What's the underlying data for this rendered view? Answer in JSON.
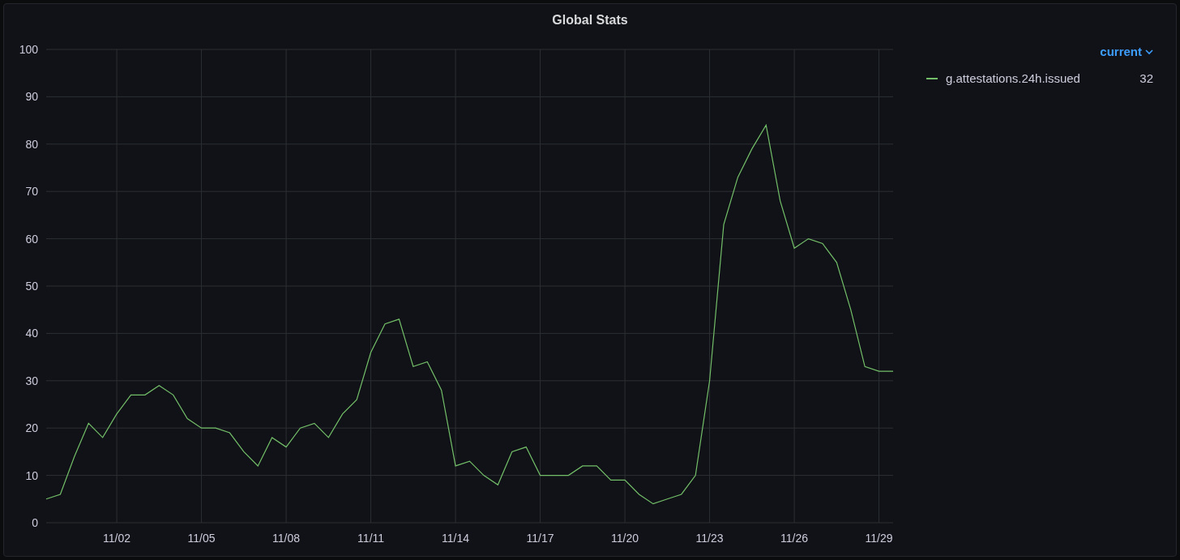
{
  "panel": {
    "title": "Global Stats",
    "chart_data": {
      "type": "line",
      "grid": true,
      "ylim": [
        0,
        100
      ],
      "yticks": [
        0,
        10,
        20,
        30,
        40,
        50,
        60,
        70,
        80,
        90,
        100
      ],
      "categories": [
        null,
        null,
        null,
        null,
        null,
        "11/02",
        null,
        null,
        null,
        null,
        null,
        "11/05",
        null,
        null,
        null,
        null,
        null,
        "11/08",
        null,
        null,
        null,
        null,
        null,
        "11/11",
        null,
        null,
        null,
        null,
        null,
        "11/14",
        null,
        null,
        null,
        null,
        null,
        "11/17",
        null,
        null,
        null,
        null,
        null,
        "11/20",
        null,
        null,
        null,
        null,
        null,
        "11/23",
        null,
        null,
        null,
        null,
        null,
        "11/26",
        null,
        null,
        null,
        null,
        null,
        "11/29",
        null
      ],
      "series": [
        {
          "name": "g.attestations.24h.issued",
          "color": "#73bf69",
          "values": [
            5,
            6,
            14,
            21,
            18,
            23,
            27,
            27,
            29,
            27,
            22,
            20,
            20,
            19,
            15,
            12,
            18,
            16,
            20,
            21,
            18,
            23,
            26,
            36,
            42,
            43,
            33,
            34,
            28,
            12,
            13,
            10,
            8,
            15,
            16,
            10,
            10,
            10,
            12,
            12,
            9,
            9,
            6,
            4,
            5,
            6,
            10,
            30,
            63,
            73,
            79,
            84,
            68,
            58,
            60,
            59,
            55,
            45,
            33,
            32,
            32
          ]
        }
      ]
    }
  },
  "legend": {
    "sort_label": "current",
    "items": [
      {
        "value": "32"
      }
    ]
  }
}
